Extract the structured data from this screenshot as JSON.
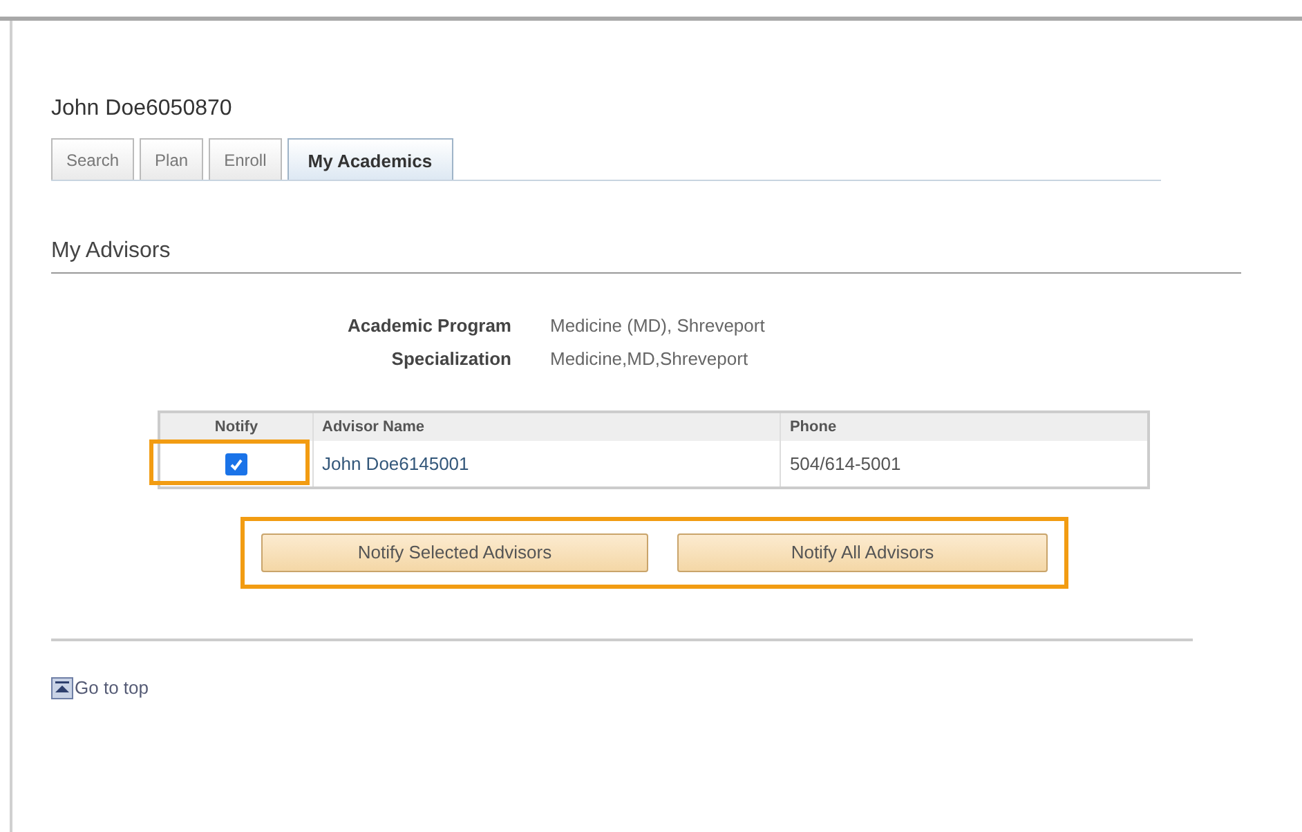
{
  "student_name": "John Doe6050870",
  "tabs": [
    {
      "label": "Search",
      "selected": false
    },
    {
      "label": "Plan",
      "selected": false
    },
    {
      "label": "Enroll",
      "selected": false
    },
    {
      "label": "My Academics",
      "selected": true
    }
  ],
  "section_title": "My Advisors",
  "fields": [
    {
      "label": "Academic Program",
      "value": "Medicine (MD), Shreveport"
    },
    {
      "label": "Specialization",
      "value": "Medicine,MD,Shreveport"
    }
  ],
  "table": {
    "columns": [
      "Notify",
      "Advisor Name",
      "Phone"
    ],
    "rows": [
      {
        "notify": true,
        "advisor_name": "John Doe6145001",
        "phone": "504/614-5001",
        "highlighted": true
      }
    ]
  },
  "buttons": [
    "Notify Selected Advisors",
    "Notify All Advisors"
  ],
  "buttons_highlighted": true,
  "go_to_top": "Go to top"
}
